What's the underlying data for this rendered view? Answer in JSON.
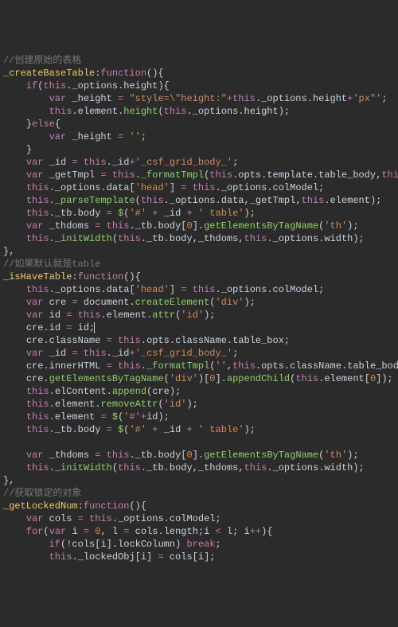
{
  "comments": {
    "c1": "//创建原始的表格",
    "c2": "//如果默认就是table",
    "c3": "//获取锁定的对象"
  },
  "fn_names": {
    "createBaseTable": "_createBaseTable",
    "isHaveTable": "_isHaveTable",
    "getLockedNum": "_getLockedNum"
  },
  "kw": {
    "function": "function",
    "if": "if",
    "else": "else",
    "var": "var",
    "this": "this",
    "for": "for",
    "break": "break"
  },
  "ids": {
    "_options": "_options",
    "height": "height",
    "_height": "_height",
    "element": "element",
    "_id": "_id",
    "_getTmpl": "_getTmpl",
    "opts": "opts",
    "template": "template",
    "table_body": "table_body",
    "data": "data",
    "colModel": "colModel",
    "_tb": "_tb",
    "body": "body",
    "_thdoms": "_thdoms",
    "width": "width",
    "cre": "cre",
    "document": "document",
    "id": "id",
    "className": "className",
    "table_box": "table_box",
    "innerHTML": "innerHTML",
    "elContent": "elContent",
    "cols": "cols",
    "i": "i",
    "l": "l",
    "length": "length",
    "lockColumn": "lockColumn",
    "_lockedObj": "_lockedObj"
  },
  "calls": {
    "height": "height",
    "_formatTmpl": "_formatTmpl",
    "_parseTemplate": "_parseTemplate",
    "dollar": "$",
    "getElementsByTagName": "getElementsByTagName",
    "_initWidth": "_initWidth",
    "createElement": "createElement",
    "attr": "attr",
    "append": "append",
    "removeAttr": "removeAttr",
    "appendChild": "appendChild"
  },
  "strings": {
    "style_h": "\"style=\\\"height:\"",
    "px": "'px\"'",
    "csf": "'_csf_grid_body_'",
    "head": "'head'",
    "hash": "'#'",
    "table": "' table'",
    "th": "'th'",
    "div": "'div'",
    "idstr": "'id'",
    "empty": "''",
    "hash_plain": "'#'"
  },
  "nums": {
    "zero": "0"
  },
  "chart_data": null
}
